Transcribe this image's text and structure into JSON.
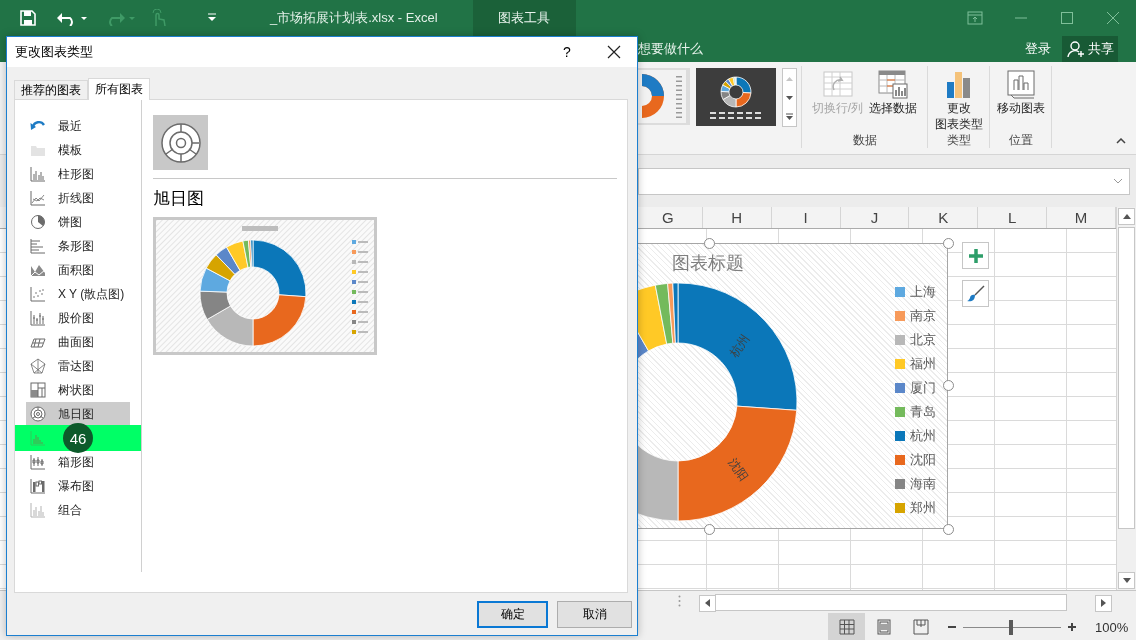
{
  "app": {
    "title": "_市场拓展计划表.xlsx - Excel",
    "context_tab": "图表工具",
    "search_hint": "想要做什么",
    "sign_in": "登录",
    "share": "共享"
  },
  "ribbon": {
    "groups": [
      {
        "label": "数据",
        "buttons": [
          {
            "kind": "switch",
            "lines": [
              "切换行/列"
            ],
            "disabled": true
          },
          {
            "kind": "select",
            "lines": [
              "选择数据"
            ],
            "disabled": false
          }
        ]
      },
      {
        "label": "类型",
        "buttons": [
          {
            "kind": "change",
            "lines": [
              "更改",
              "图表类型"
            ],
            "disabled": false
          }
        ]
      },
      {
        "label": "位置",
        "buttons": [
          {
            "kind": "move",
            "lines": [
              "移动图表"
            ],
            "disabled": false
          }
        ]
      }
    ]
  },
  "sheet": {
    "columns": [
      "G",
      "H",
      "I",
      "J",
      "K",
      "L",
      "M"
    ]
  },
  "chart": {
    "title": "图表标题",
    "slice_labels": [
      "杭州",
      "沈阳"
    ],
    "legend": [
      {
        "label": "上海",
        "color": "#5ea9e0"
      },
      {
        "label": "南京",
        "color": "#f79a5a"
      },
      {
        "label": "北京",
        "color": "#b8b8b8"
      },
      {
        "label": "福州",
        "color": "#ffc926"
      },
      {
        "label": "厦门",
        "color": "#5b87c9"
      },
      {
        "label": "青岛",
        "color": "#74ba5c"
      },
      {
        "label": "杭州",
        "color": "#0b77b9"
      },
      {
        "label": "沈阳",
        "color": "#e8681e"
      },
      {
        "label": "海南",
        "color": "#858585"
      },
      {
        "label": "郑州",
        "color": "#d6a400"
      }
    ]
  },
  "dialog": {
    "title": "更改图表类型",
    "help": "?",
    "tabs": [
      {
        "label": "推荐的图表",
        "selected": false
      },
      {
        "label": "所有图表",
        "selected": true
      }
    ],
    "categories": [
      {
        "kind": "recent",
        "label": "最近",
        "selected": false
      },
      {
        "kind": "template",
        "label": "模板",
        "selected": false
      },
      {
        "kind": "column",
        "label": "柱形图",
        "selected": false
      },
      {
        "kind": "line",
        "label": "折线图",
        "selected": false
      },
      {
        "kind": "pie",
        "label": "饼图",
        "selected": false
      },
      {
        "kind": "bar",
        "label": "条形图",
        "selected": false
      },
      {
        "kind": "area",
        "label": "面积图",
        "selected": false
      },
      {
        "kind": "scatter",
        "label": "X Y (散点图)",
        "selected": false
      },
      {
        "kind": "stock",
        "label": "股价图",
        "selected": false
      },
      {
        "kind": "surface",
        "label": "曲面图",
        "selected": false
      },
      {
        "kind": "radar",
        "label": "雷达图",
        "selected": false
      },
      {
        "kind": "treemap",
        "label": "树状图",
        "selected": false
      },
      {
        "kind": "sunburst",
        "label": "旭日图",
        "selected": true
      },
      {
        "kind": "histogram",
        "highlight": "46"
      },
      {
        "kind": "box",
        "label": "箱形图",
        "selected": false
      },
      {
        "kind": "waterfall",
        "label": "瀑布图",
        "selected": false
      },
      {
        "kind": "combo",
        "label": "组合",
        "selected": false
      }
    ],
    "detail": {
      "heading": "旭日图"
    },
    "buttons": [
      {
        "label": "确定",
        "default": true
      },
      {
        "label": "取消",
        "default": false
      }
    ]
  },
  "status": {
    "views": [
      {
        "kind": "normal",
        "selected": true
      },
      {
        "kind": "layout",
        "selected": false
      },
      {
        "kind": "pagebreak",
        "selected": false
      }
    ],
    "zoom": {
      "level": 0.49,
      "reading": "100%"
    }
  }
}
